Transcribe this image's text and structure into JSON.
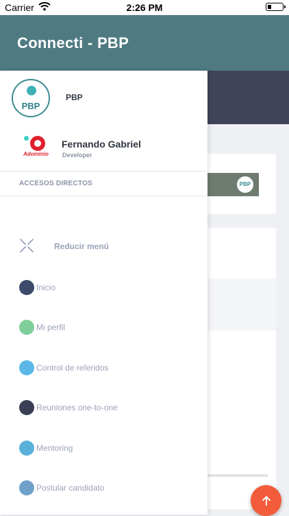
{
  "status_bar": {
    "carrier": "Carrier",
    "time": "2:26 PM"
  },
  "app_bar": {
    "title": "Connecti - PBP"
  },
  "drawer": {
    "organization": {
      "logo_text": "PBP",
      "name": "PBP"
    },
    "user": {
      "logo_text": "Adominio",
      "name": "Fernando Gabriel",
      "role": "Developer"
    },
    "section_title": "ACCESOS DIRECTOS",
    "collapse_label": "Reducir menú",
    "menu_items": [
      {
        "label": "Inicio",
        "icon": "compass-icon",
        "color": "#3c4a6b"
      },
      {
        "label": "Mi perfil",
        "icon": "user-avatar-icon",
        "color": "#7fcf9a"
      },
      {
        "label": "Control de referidos",
        "icon": "referrals-icon",
        "color": "#5bb8e6"
      },
      {
        "label": "Reuniones one-to-one",
        "icon": "meeting-person-icon",
        "color": "#3a3f55"
      },
      {
        "label": "Mentoring",
        "icon": "mentoring-icon",
        "color": "#59b0d8"
      },
      {
        "label": "Postular candidato",
        "icon": "candidate-icon",
        "color": "#6fa0c9"
      }
    ]
  },
  "background": {
    "thumbnail_logo_text": "PBP"
  },
  "fab": {
    "icon": "arrow-up-icon",
    "color": "#f25c3a"
  },
  "colors": {
    "app_bar": "#4f7a82",
    "drawer_text": "#9aa2b8",
    "accent": "#f25c3a"
  }
}
